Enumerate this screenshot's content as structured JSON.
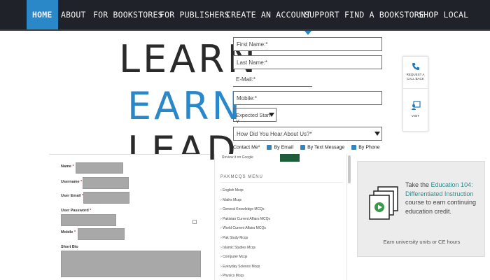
{
  "nav": {
    "items": [
      "HOME",
      "ABOUT",
      "FOR BOOKSTORES",
      "FOR PUBLISHERS",
      "CREATE AN ACCOUNT",
      "SUPPORT",
      "FIND A BOOKSTORE",
      "SHOP LOCAL"
    ],
    "active": "HOME"
  },
  "hero": {
    "words": [
      "LEARN",
      "EARN",
      "LEAD"
    ]
  },
  "form": {
    "first_name": "First Name:*",
    "last_name": "Last Name:*",
    "email": "E-Mail:*",
    "mobile": "Mobile:*",
    "expected_start": "Expected Start Y",
    "heard_about": "How Did You Hear About Us?*",
    "contact_label": "Contact Me*",
    "contact_options": [
      "By Email",
      "By Text Message",
      "By Phone"
    ]
  },
  "side_widget": {
    "call_label_1": "REQUEST A",
    "call_label_2": "CALL BACK",
    "visit_label": "VISIT"
  },
  "profile_form": {
    "labels": [
      "Name",
      "Username",
      "User Email",
      "User Password",
      "Mobile",
      "Short Bio"
    ],
    "required_mark": "*"
  },
  "menu": {
    "google_text": "Review it on Google",
    "title": "PAKMCQS MENU",
    "items": [
      "English Mcqs",
      "Maths Mcqs",
      "General Knowledge MCQs",
      "Pakistan Current Affairs MCQs",
      "World Current Affairs MCQs",
      "Pak Study Mcqs",
      "Islamic Studies Mcqs",
      "Computer Mcqs",
      "Everyday Science Mcqs",
      "Physics Mcqs"
    ]
  },
  "course_card": {
    "text_before": "Take the ",
    "link_text": "Education 104: Differentiated Instruction",
    "text_after": " course to earn continuing education credit.",
    "footer": "Earn university units or CE hours"
  },
  "colors": {
    "accent": "#2a87c8",
    "nav_bg": "#1f2228",
    "link": "#2d8a8a",
    "menu_button": "#1e5c3a"
  }
}
